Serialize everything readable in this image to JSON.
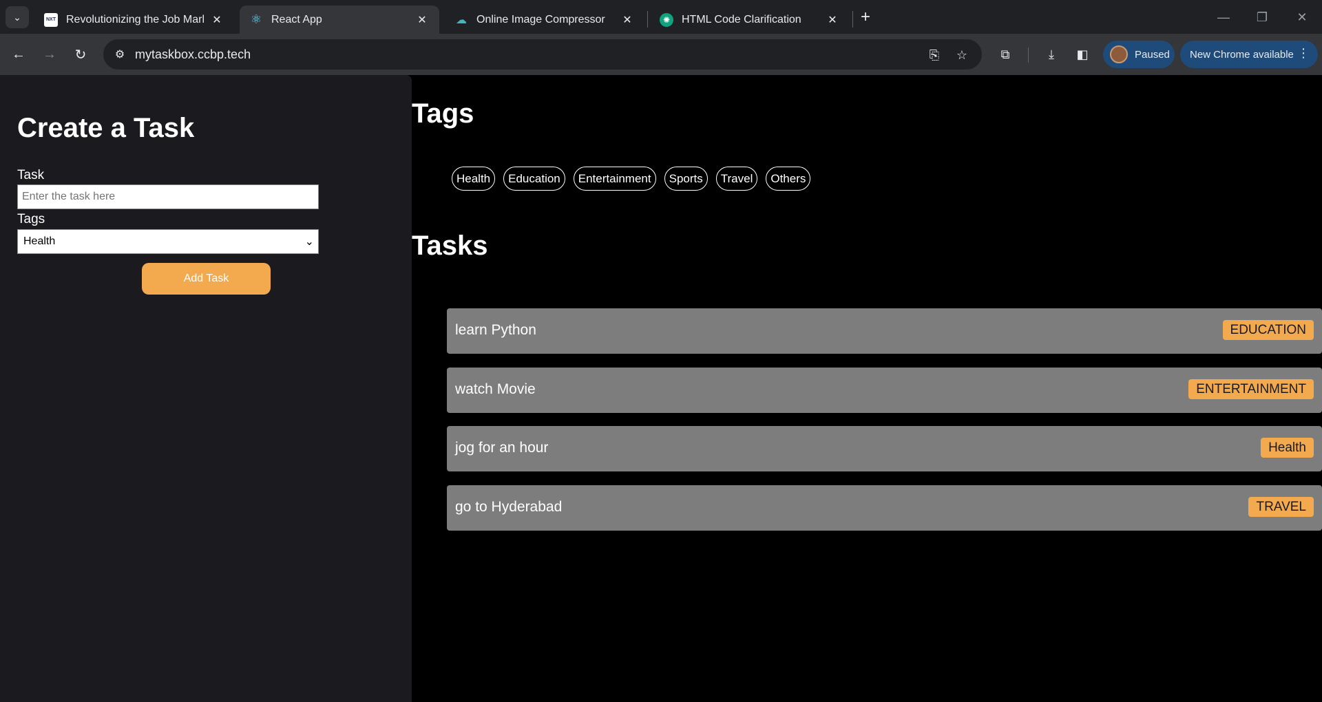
{
  "browser": {
    "tabs": [
      {
        "title": "Revolutionizing the Job Market",
        "favicon": "nxtwave-icon",
        "active": false
      },
      {
        "title": "React App",
        "favicon": "react-icon",
        "active": true
      },
      {
        "title": "Online Image Compressor",
        "favicon": "compressor-icon",
        "active": false
      },
      {
        "title": "HTML Code Clarification",
        "favicon": "chatgpt-icon",
        "active": false
      }
    ],
    "url": "mytaskbox.ccbp.tech",
    "profile_label": "Paused",
    "update_label": "New Chrome available"
  },
  "form": {
    "title": "Create a Task",
    "task_label": "Task",
    "task_placeholder": "Enter the task here",
    "task_value": "",
    "tags_label": "Tags",
    "tags_selected": "Health",
    "add_button": "Add Task"
  },
  "tags_section": {
    "title": "Tags",
    "tags": [
      "Health",
      "Education",
      "Entertainment",
      "Sports",
      "Travel",
      "Others"
    ]
  },
  "tasks_section": {
    "title": "Tasks",
    "tasks": [
      {
        "text": "learn Python",
        "tag": "EDUCATION"
      },
      {
        "text": "watch Movie",
        "tag": "ENTERTAINMENT"
      },
      {
        "text": "jog for an hour",
        "tag": "Health"
      },
      {
        "text": "go to Hyderabad",
        "tag": "TRAVEL"
      }
    ]
  },
  "colors": {
    "accent": "#f3aa4e",
    "panel": "#1b1a1f",
    "card": "#7d7d7d"
  }
}
